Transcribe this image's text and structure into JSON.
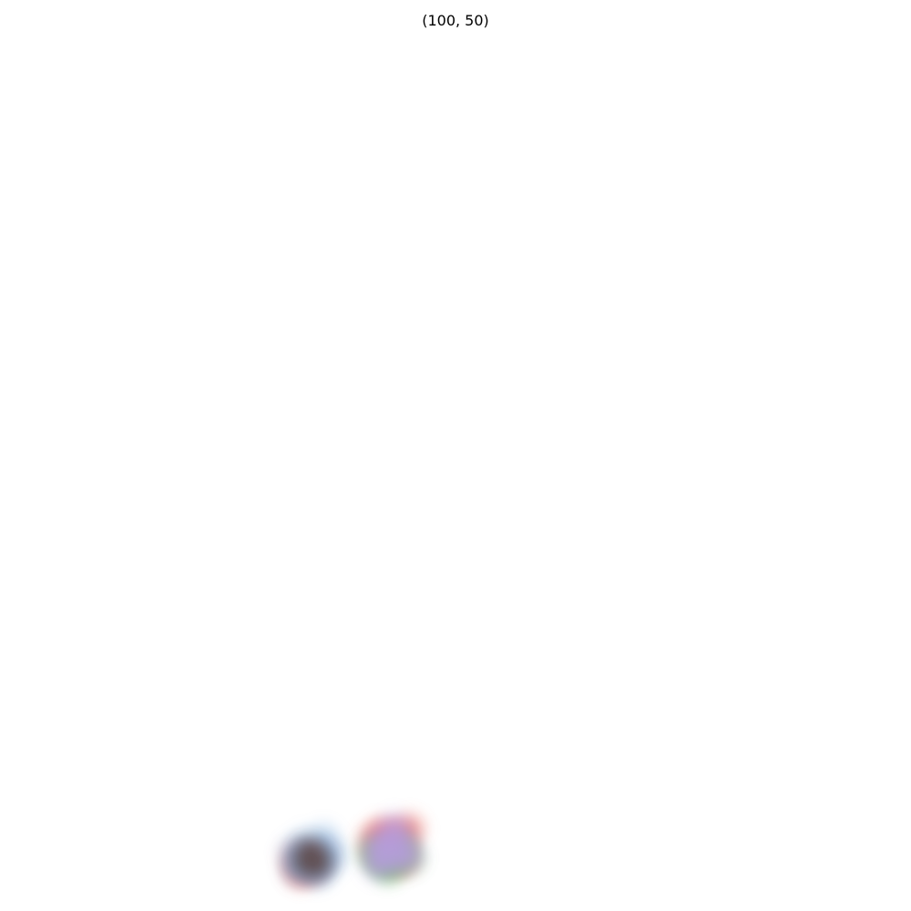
{
  "chart_data": {
    "type": "kde",
    "title": "(100, 50)",
    "axes": "off",
    "grid": false,
    "legend": "none",
    "series": [
      {
        "color": "#e8736a",
        "points": [
          [
            43.6,
            6.0
          ],
          [
            45.0,
            9.7
          ],
          [
            41.9,
            9.2
          ],
          [
            42.7,
            7.6
          ],
          [
            44.4,
            9.0
          ],
          [
            43.2,
            7.5
          ],
          [
            42.8,
            6.6
          ],
          [
            32.4,
            6.3
          ],
          [
            33.8,
            4.8
          ],
          [
            34.5,
            5.1
          ],
          [
            32.7,
            5.0
          ],
          [
            34.1,
            5.8
          ],
          [
            33.4,
            6.2
          ],
          [
            44.2,
            5.9
          ],
          [
            40.9,
            8.4
          ],
          [
            43.9,
            8.2
          ],
          [
            41.5,
            7.1
          ],
          [
            42.1,
            8.8
          ],
          [
            35.2,
            6.6
          ],
          [
            33.0,
            4.4
          ]
        ]
      },
      {
        "color": "#7fb0e0",
        "points": [
          [
            33.8,
            5.3
          ],
          [
            35.9,
            6.9
          ],
          [
            33.1,
            5.7
          ],
          [
            35.2,
            4.9
          ],
          [
            32.3,
            6.8
          ],
          [
            36.3,
            6.2
          ],
          [
            34.7,
            4.5
          ],
          [
            33.5,
            7.8
          ],
          [
            35.5,
            8.4
          ],
          [
            32.6,
            4.9
          ]
        ]
      },
      {
        "color": "#6bc46b",
        "points": [
          [
            42.1,
            5.8
          ],
          [
            43.5,
            6.8
          ],
          [
            41.4,
            6.2
          ],
          [
            44.9,
            6.1
          ],
          [
            43.0,
            5.4
          ],
          [
            44.2,
            7.3
          ],
          [
            40.9,
            7.0
          ],
          [
            42.6,
            4.9
          ]
        ]
      },
      {
        "color": "#b99be0",
        "points": [
          [
            42.8,
            8.8
          ],
          [
            43.3,
            9.7
          ],
          [
            41.7,
            6.4
          ],
          [
            44.4,
            7.0
          ],
          [
            42.4,
            5.6
          ],
          [
            43.9,
            6.0
          ],
          [
            42.0,
            8.0
          ],
          [
            44.0,
            8.5
          ],
          [
            41.4,
            5.3
          ],
          [
            43.0,
            7.4
          ],
          [
            44.9,
            6.4
          ],
          [
            41.2,
            7.3
          ]
        ]
      },
      {
        "color": "#5e4a4a",
        "points": [
          [
            33.4,
            5.6
          ],
          [
            35.0,
            5.7
          ],
          [
            34.2,
            6.5
          ],
          [
            34.6,
            5.4
          ],
          [
            33.9,
            6.9
          ]
        ]
      }
    ]
  }
}
